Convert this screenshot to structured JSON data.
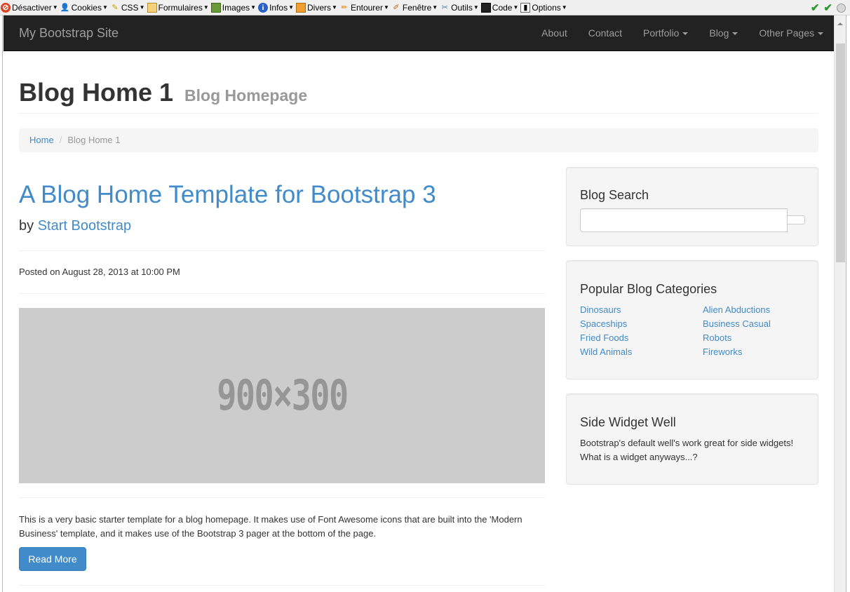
{
  "devbar": {
    "items": [
      {
        "label": "Désactiver",
        "icon": "disable-icon"
      },
      {
        "label": "Cookies",
        "icon": "cookies-icon"
      },
      {
        "label": "CSS",
        "icon": "css-icon"
      },
      {
        "label": "Formulaires",
        "icon": "forms-icon"
      },
      {
        "label": "Images",
        "icon": "images-icon"
      },
      {
        "label": "Infos",
        "icon": "info-icon"
      },
      {
        "label": "Divers",
        "icon": "misc-icon"
      },
      {
        "label": "Entourer",
        "icon": "outline-icon"
      },
      {
        "label": "Fenêtre",
        "icon": "resize-icon"
      },
      {
        "label": "Outils",
        "icon": "tools-icon"
      },
      {
        "label": "Code",
        "icon": "code-icon"
      },
      {
        "label": "Options",
        "icon": "options-icon"
      }
    ]
  },
  "navbar": {
    "brand": "My Bootstrap Site",
    "links": {
      "about": "About",
      "contact": "Contact",
      "portfolio": "Portfolio",
      "blog": "Blog",
      "other": "Other Pages"
    }
  },
  "header": {
    "title": "Blog Home 1",
    "subtitle": "Blog Homepage"
  },
  "breadcrumb": {
    "home": "Home",
    "separator": "/",
    "current": "Blog Home 1"
  },
  "post": {
    "title": "A Blog Home Template for Bootstrap 3",
    "by_prefix": "by",
    "author": "Start Bootstrap",
    "posted": "Posted on August 28, 2013 at 10:00 PM",
    "image_label": "900×300",
    "excerpt": "This is a very basic starter template for a blog homepage. It makes use of Font Awesome icons that are built into the 'Modern Business' template, and it makes use of the Bootstrap 3 pager at the bottom of the page.",
    "read_more": "Read More"
  },
  "sidebar": {
    "search": {
      "title": "Blog Search",
      "value": ""
    },
    "categories": {
      "title": "Popular Blog Categories",
      "col1": [
        "Dinosaurs",
        "Spaceships",
        "Fried Foods",
        "Wild Animals"
      ],
      "col2": [
        "Alien Abductions",
        "Business Casual",
        "Robots",
        "Fireworks"
      ]
    },
    "widget": {
      "title": "Side Widget Well",
      "text": "Bootstrap's default well's work great for side widgets! What is a widget anyways...?"
    }
  },
  "colors": {
    "link": "#428bca",
    "navbar_bg": "#222222",
    "navbar_text": "#9d9d9d",
    "well_bg": "#f5f5f5",
    "placeholder_bg": "#cccccc"
  }
}
